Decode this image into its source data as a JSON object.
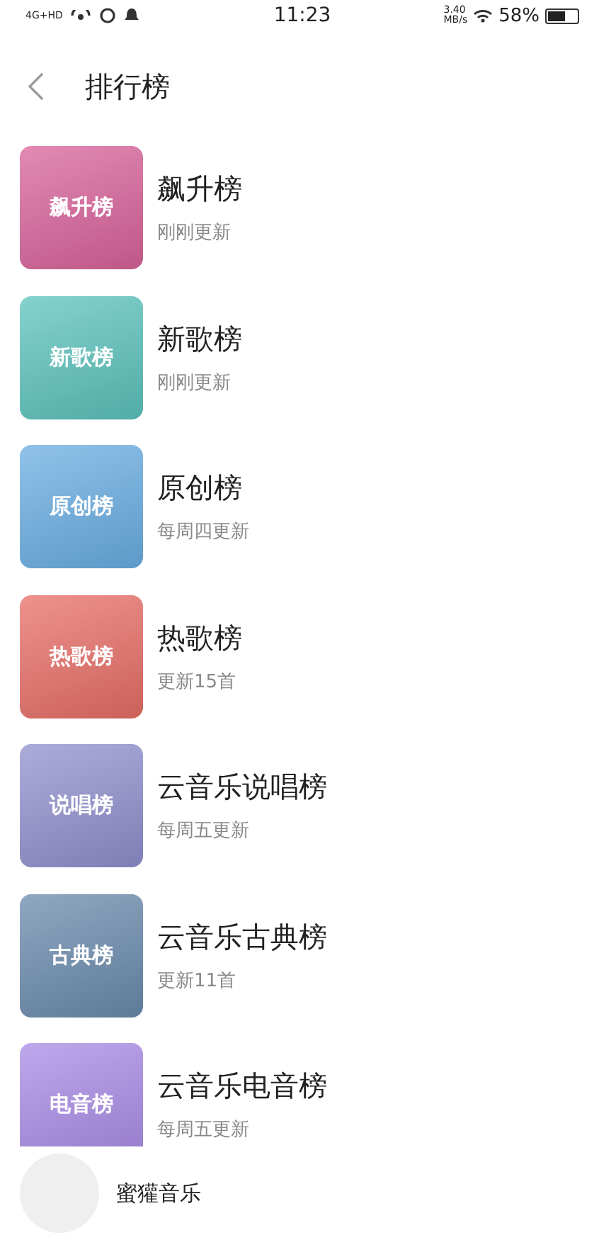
{
  "status_bar": {
    "network": "4G+HD",
    "time": "11:23",
    "speed": "3.40",
    "speed_unit": "MB/s",
    "battery": "58%"
  },
  "header": {
    "title": "排行榜"
  },
  "charts": [
    {
      "cover": "飙升榜",
      "name": "飙升榜",
      "update": "刚刚更新",
      "color": "#d9639b"
    },
    {
      "cover": "新歌榜",
      "name": "新歌榜",
      "update": "刚刚更新",
      "color": "#5cc3bd"
    },
    {
      "cover": "原创榜",
      "name": "原创榜",
      "update": "每周四更新",
      "color": "#6aaee3"
    },
    {
      "cover": "热歌榜",
      "name": "热歌榜",
      "update": "更新15首",
      "color": "#e86e67"
    },
    {
      "cover": "说唱榜",
      "name": "云音乐说唱榜",
      "update": "每周五更新",
      "color": "#9090cf"
    },
    {
      "cover": "古典榜",
      "name": "云音乐古典榜",
      "update": "更新11首",
      "color": "#6a8bad"
    },
    {
      "cover": "电音榜",
      "name": "云音乐电音榜",
      "update": "每周五更新",
      "color": "#a98be6"
    }
  ],
  "mini_player": {
    "title": "蜜獾音乐"
  }
}
